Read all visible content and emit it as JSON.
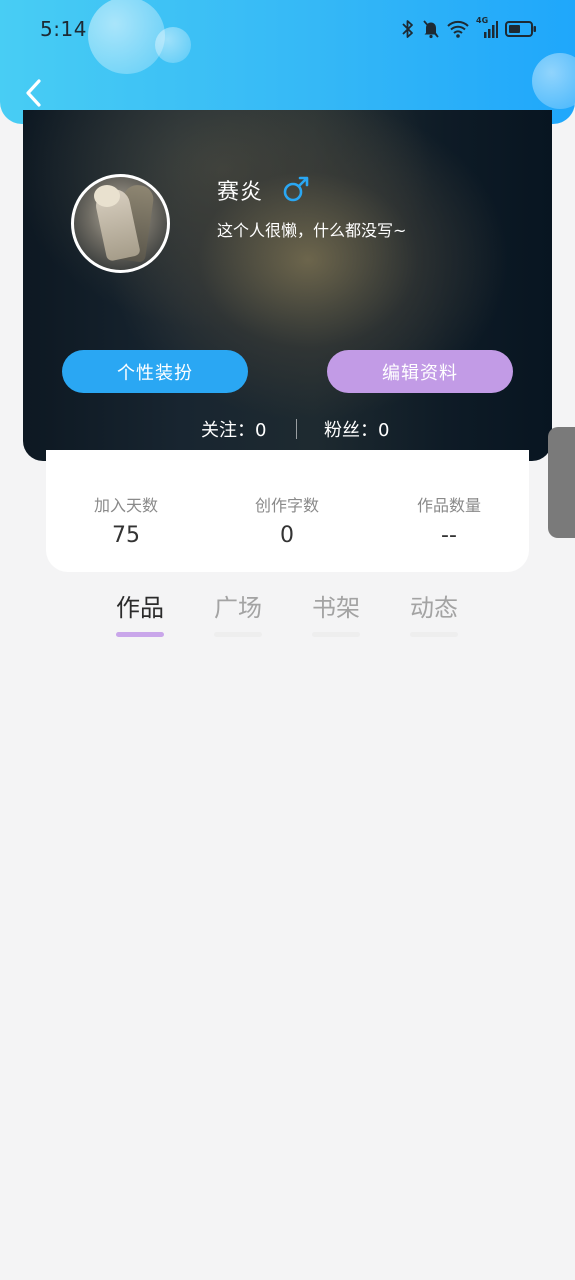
{
  "status_bar": {
    "time": "5:14",
    "network_label": "4G"
  },
  "header": {
    "back_icon": "chevron-left-icon"
  },
  "profile": {
    "username": "赛炎",
    "gender_symbol": "♂",
    "bio": "这个人很懒，什么都没写~",
    "buttons": {
      "dress_label": "个性装扮",
      "edit_label": "编辑资料"
    },
    "follow": {
      "following": "关注：0",
      "fans": "粉丝：0"
    }
  },
  "stats": [
    {
      "label": "加入天数",
      "value": "75"
    },
    {
      "label": "创作字数",
      "value": "0"
    },
    {
      "label": "作品数量",
      "value": "--"
    }
  ],
  "tabs": [
    {
      "label": "作品",
      "active": true
    },
    {
      "label": "广场",
      "active": false
    },
    {
      "label": "书架",
      "active": false
    },
    {
      "label": "动态",
      "active": false
    }
  ],
  "colors": {
    "header_start": "#48cdf4",
    "header_end": "#1fa7fb",
    "dress_button": "#2aa7f3",
    "edit_button": "#c29be6",
    "tab_active_underline": "#c9a6ea",
    "gender_icon": "#2aa7f3"
  }
}
